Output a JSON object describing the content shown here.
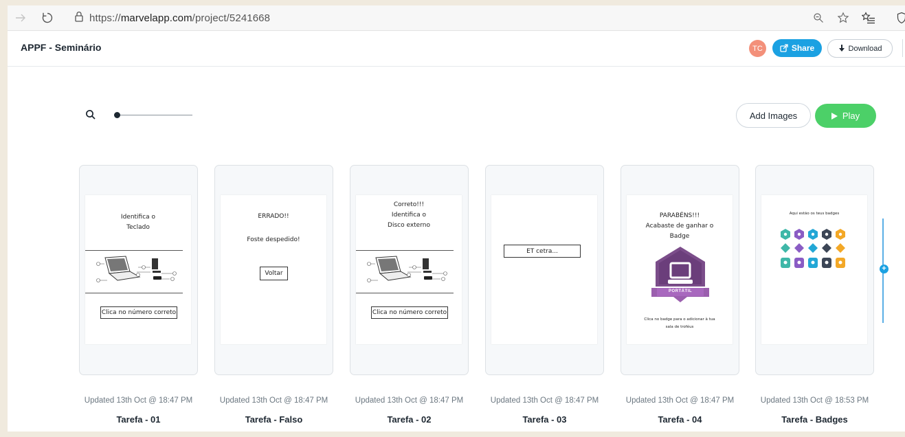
{
  "browser": {
    "url_prefix": "https://",
    "url_domain": "marvelapp.com",
    "url_path": "/project/5241668"
  },
  "header": {
    "project_title": "APPF - Seminário",
    "avatar_initials": "TC",
    "share_label": "Share",
    "download_label": "Download"
  },
  "toolbar": {
    "add_images_label": "Add Images",
    "play_label": "Play"
  },
  "screens": [
    {
      "updated": "Updated 13th Oct @ 18:47 PM",
      "name": "Tarefa - 01",
      "content": {
        "line1": "Identifica o",
        "line2": "Teclado",
        "button": "Clica no número correto"
      }
    },
    {
      "updated": "Updated 13th Oct @ 18:47 PM",
      "name": "Tarefa - Falso",
      "content": {
        "line1": "ERRADO!!",
        "line2": "Foste despedido!",
        "button": "Voltar"
      }
    },
    {
      "updated": "Updated 13th Oct @ 18:47 PM",
      "name": "Tarefa - 02",
      "content": {
        "line1": "Correto!!!",
        "line2": "Identifica o",
        "line3": "Disco externo",
        "button": "Clica no número correto"
      }
    },
    {
      "updated": "Updated 13th Oct @ 18:47 PM",
      "name": "Tarefa - 03",
      "content": {
        "button": "ET cetra..."
      }
    },
    {
      "updated": "Updated 13th Oct @ 18:47 PM",
      "name": "Tarefa - 04",
      "content": {
        "line1": "PARABÉNS!!!",
        "line2": "Acabaste de ganhar o",
        "line3": "Badge",
        "badge_label": "PORTÁTIL",
        "footer1": "Clica no badge para o adicionar à tua",
        "footer2": "sala de troféus"
      }
    },
    {
      "updated": "Updated 13th Oct @ 18:53 PM",
      "name": "Tarefa - Badges",
      "content": {
        "title": "Aqui estão os teus badges"
      }
    }
  ],
  "colors": {
    "share": "#1ba1e2",
    "play": "#4cd068",
    "avatar": "#f3907a",
    "badge_purple": "#7b4d8a"
  }
}
